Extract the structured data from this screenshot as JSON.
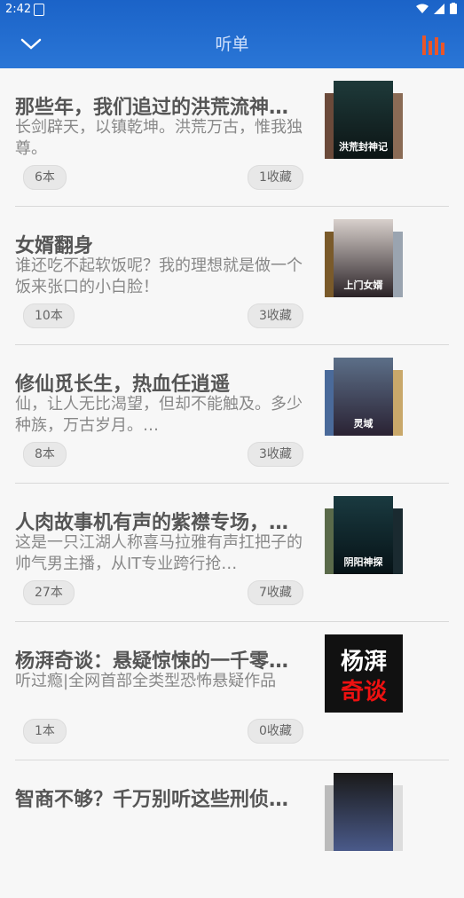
{
  "status_bar": {
    "time": "2:42"
  },
  "header": {
    "title": "听单"
  },
  "items": [
    {
      "title": "那些年，我们追过的洪荒流神…",
      "desc": "长剑辟天，以镇乾坤。洪荒万古，惟我独尊。",
      "count": "6本",
      "fav": "1收藏",
      "cover_text": "洪荒封神记"
    },
    {
      "title": "女婿翻身",
      "desc": "谁还吃不起软饭呢？我的理想就是做一个饭来张口的小白脸！",
      "count": "10本",
      "fav": "3收藏",
      "cover_text": "上门女婿"
    },
    {
      "title": "修仙觅长生，热血任逍遥",
      "desc": "仙，让人无比渴望，但却不能触及。多少种族，万古岁月。…",
      "count": "8本",
      "fav": "3收藏",
      "cover_text": "灵域"
    },
    {
      "title": "人肉故事机有声的紫襟专场，…",
      "desc": "这是一只江湖人称喜马拉雅有声扛把子的帅气男主播，从IT专业跨行抢…",
      "count": "27本",
      "fav": "7收藏",
      "cover_text": "阴阳神探"
    },
    {
      "title": "杨湃奇谈：悬疑惊悚的一千零…",
      "desc": "听过瘾|全网首部全类型恐怖悬疑作品",
      "count": "1本",
      "fav": "0收藏",
      "cover_text_1": "杨湃",
      "cover_text_2": "奇谈"
    },
    {
      "title": "智商不够？千万别听这些刑侦…",
      "desc": "",
      "count": "",
      "fav": ""
    }
  ],
  "colors": {
    "header": "#2a76d6",
    "accent": "#e8562a"
  }
}
